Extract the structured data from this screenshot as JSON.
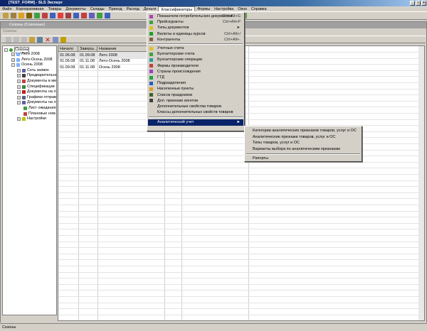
{
  "window": {
    "title": "[TEST_FORM] - SLS Эксперт"
  },
  "menu": [
    "Файл",
    "Корпоративная",
    "Товары",
    "Документы",
    "Склады",
    "Приход",
    "Расход",
    "Деньги",
    "Классификаторы",
    "Формы",
    "Настройка",
    "Окно",
    "Справка"
  ],
  "child": {
    "title": "Сезоны (Сезонные)",
    "label": "Сезоны"
  },
  "tree": {
    "root": "Сезоны",
    "items": [
      {
        "label": "Лето 2008",
        "level": 1
      },
      {
        "label": "Лето-Осень 2008",
        "level": 1
      },
      {
        "label": "Осень 2008",
        "level": 1
      },
      {
        "label": "Сеть заявок",
        "level": 2
      },
      {
        "label": "Предварительные",
        "level": 2
      },
      {
        "label": "Документы в мест.",
        "level": 2
      },
      {
        "label": "Спецификации",
        "level": 2
      },
      {
        "label": "Документы на от.",
        "level": 2
      },
      {
        "label": "Графики отправки",
        "level": 2
      },
      {
        "label": "Документы на от.",
        "level": 2
      },
      {
        "label": "Лист ожидания",
        "level": 2
      },
      {
        "label": "Плановые ном.",
        "level": 2
      },
      {
        "label": "Настройки",
        "level": 2
      }
    ]
  },
  "table": {
    "columns": [
      "Начало",
      "Заверш...",
      "Название"
    ],
    "rows": [
      [
        "01.06.08",
        "01.09.08",
        "Лето 2008"
      ],
      [
        "01.06.08",
        "01.11.08",
        "Лето-Осень 2008"
      ],
      [
        "01.09.08",
        "01.11.08",
        "Осень 2008"
      ]
    ]
  },
  "dropdown": {
    "items": [
      {
        "label": "Показатели потребительских документов",
        "shortcut": "Ctrl+Alt+G",
        "color": "#b040b0"
      },
      {
        "label": "Прейскуранты",
        "shortcut": "Ctrl+Alt+P",
        "color": "#40a040"
      },
      {
        "label": "Типы документов",
        "shortcut": "►",
        "color": "#e0c020"
      },
      {
        "label": "Валюты и единицы курсов",
        "shortcut": "Ctrl+Alt+/",
        "color": "#20a020"
      },
      {
        "label": "Контрагенты",
        "shortcut": "Ctrl+Alt+.",
        "color": "#806040"
      },
      {
        "label": "Учетные счета",
        "shortcut": "",
        "color": "#e0c020"
      },
      {
        "label": "Бухгалтерские счета",
        "shortcut": "",
        "color": "#40a040"
      },
      {
        "label": "Бухгалтерские операции",
        "shortcut": "",
        "color": "#20a0a0"
      },
      {
        "label": "Фирмы производители",
        "shortcut": "",
        "color": "#c04040"
      },
      {
        "label": "Страны происхождения",
        "shortcut": "",
        "color": "#a040c0"
      },
      {
        "label": "ГТД",
        "shortcut": "",
        "color": "#20a040"
      },
      {
        "label": "Подразделения",
        "shortcut": "",
        "color": "#2060c0"
      },
      {
        "label": "Населенные пункты",
        "shortcut": "",
        "color": "#e0a020"
      },
      {
        "label": "Список праздников",
        "shortcut": "",
        "color": "#406020"
      },
      {
        "label": "Доп. признаки агентов",
        "shortcut": "",
        "color": "#404040"
      },
      {
        "label": "Дополнительные свойства товаров",
        "shortcut": "",
        "color": ""
      },
      {
        "label": "Классы дополнительных свойств товаров",
        "shortcut": "",
        "color": ""
      }
    ],
    "highlighted": {
      "label": "Аналитический учет",
      "arrow": "►"
    }
  },
  "submenu": {
    "items": [
      "Категории аналитических признаков товаров, услуг и ОС",
      "Аналитические признаки товаров, услуг и ОС",
      "Типы товаров, услуг и ОС",
      "Варианты выбора по аналитическим признакам"
    ],
    "last": "Рапорты"
  },
  "status": "Сезоны"
}
